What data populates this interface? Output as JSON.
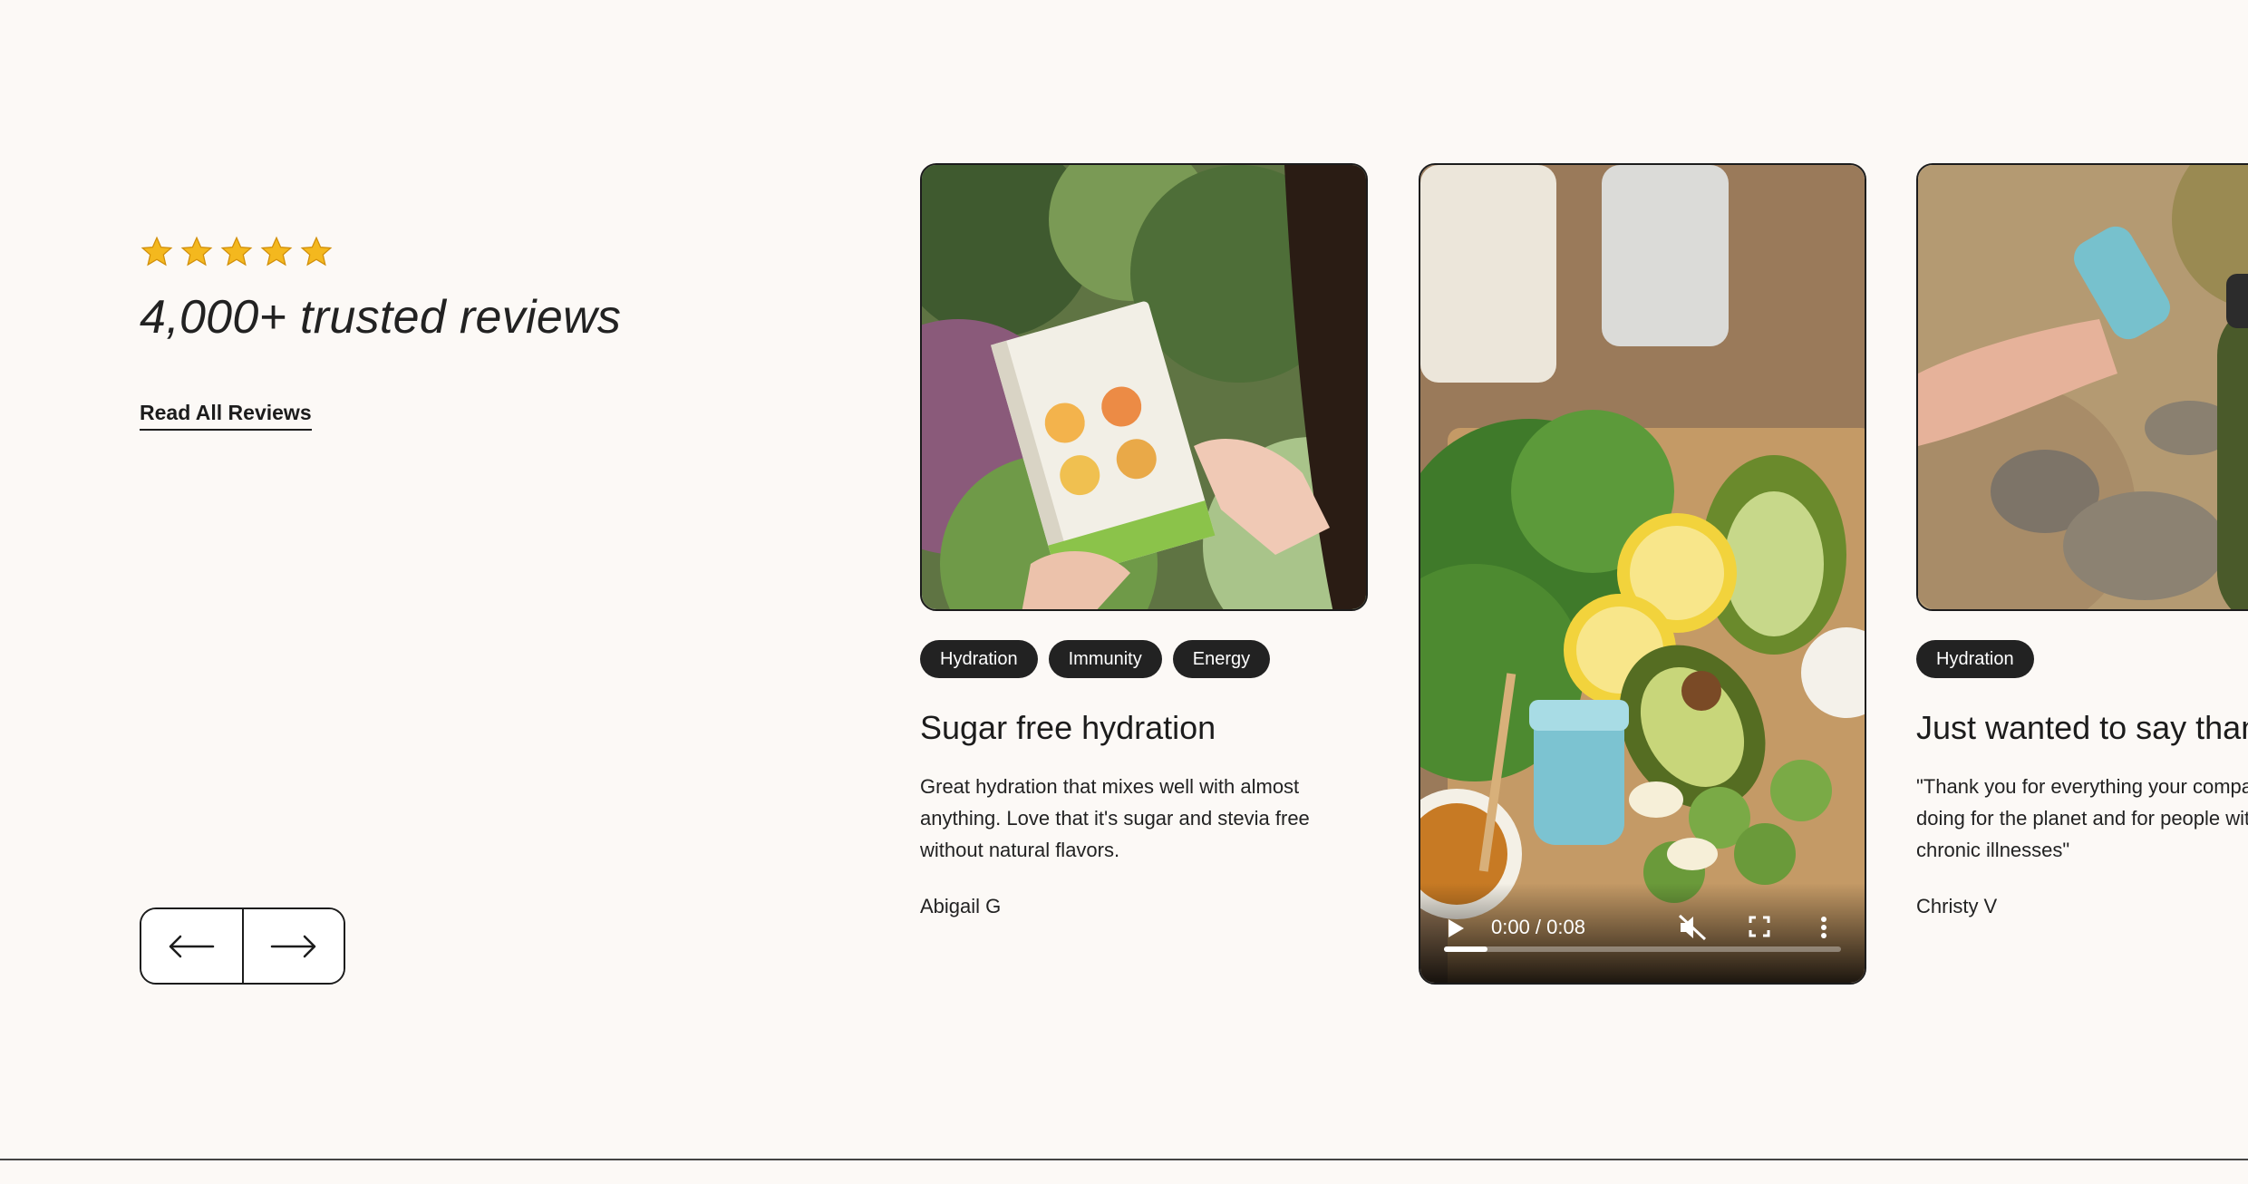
{
  "rating": {
    "stars": 5,
    "star_color": "#f4b81e"
  },
  "intro": {
    "headline": "4,000+ trusted reviews",
    "read_all_label": "Read All Reviews"
  },
  "nav": {
    "prev_icon": "arrow-left-icon",
    "next_icon": "arrow-right-icon"
  },
  "cards": [
    {
      "tags": [
        "Hydration",
        "Immunity",
        "Energy"
      ],
      "title": "Sugar free hydration",
      "body_lines": [
        "Great hydration that mixes well with almost",
        "anything. Love that it's sugar and stevia free",
        "without natural flavors."
      ],
      "author": "Abigail G"
    },
    {
      "tags": [
        "Hydration"
      ],
      "title": "Just wanted to say thank you",
      "body_lines": [
        "\"Thank you for everything your company is",
        "doing for the planet and for people with",
        "chronic illnesses\""
      ],
      "author": "Christy V"
    }
  ],
  "video": {
    "time_label": "0:00 / 0:08",
    "progress": 0.11,
    "icons": [
      "play-icon",
      "mute-icon",
      "fullscreen-icon",
      "more-options-icon"
    ]
  },
  "colors": {
    "background": "#fcf9f6",
    "tag_bg": "#222222",
    "text": "#1c1c1c"
  }
}
